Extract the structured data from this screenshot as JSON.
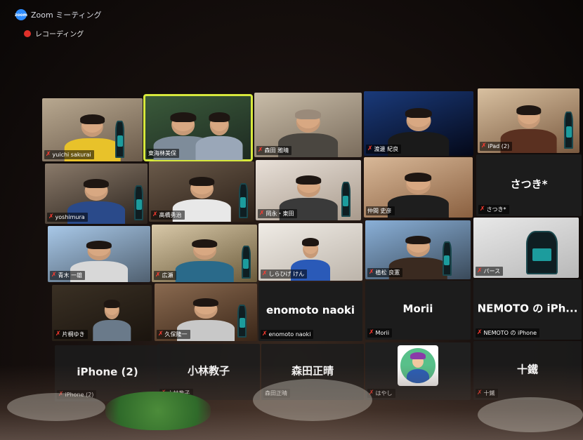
{
  "window": {
    "title": "Zoom ミーティング",
    "logo_text": "zoom"
  },
  "recording": {
    "label": "レコーディング"
  },
  "mic_muted_glyph": "✗",
  "colors": {
    "active_speaker_border": "#d7e83c",
    "muted_mic": "#ff3b30",
    "recording_dot": "#e0302a",
    "zoom_blue": "#2d8cff"
  },
  "participants": [
    {
      "name": "yuichi sakurai",
      "muted": true,
      "video": true
    },
    {
      "name": "東海林美保",
      "muted": false,
      "video": true,
      "active_speaker": true
    },
    {
      "name": "森田 雅晴",
      "muted": true,
      "video": true
    },
    {
      "name": "渡邊 紀良",
      "muted": true,
      "video": true
    },
    {
      "name": "iPad (2)",
      "muted": true,
      "video": true
    },
    {
      "name": "yoshimura",
      "muted": true,
      "video": true
    },
    {
      "name": "髙橋勇治",
      "muted": true,
      "video": true
    },
    {
      "name": "岡永・東田",
      "muted": true,
      "video": true
    },
    {
      "name": "仲間 史彦",
      "muted": false,
      "video": true
    },
    {
      "name": "さつき*",
      "display": "さつき*",
      "muted": true,
      "video": false
    },
    {
      "name": "青木 一雄",
      "muted": true,
      "video": true
    },
    {
      "name": "広瀬",
      "muted": true,
      "video": true
    },
    {
      "name": "しらひげ けん",
      "muted": true,
      "video": true
    },
    {
      "name": "植松 良憲",
      "muted": true,
      "video": true
    },
    {
      "name": "パース",
      "muted": true,
      "video": true
    },
    {
      "name": "片桐ゆき",
      "muted": true,
      "video": true
    },
    {
      "name": "久保隆一",
      "muted": true,
      "video": true
    },
    {
      "name": "enomoto naoki",
      "display": "enomoto naoki",
      "muted": true,
      "video": false
    },
    {
      "name": "Morii",
      "display": "Morii",
      "muted": true,
      "video": false
    },
    {
      "name": "NEMOTO の iPhone",
      "display": "NEMOTO の iPh...",
      "muted": true,
      "video": false
    },
    {
      "name": "iPhone (2)",
      "display": "iPhone (2)",
      "muted": true,
      "video": false
    },
    {
      "name": "小林教子",
      "display": "小林教子",
      "muted": true,
      "video": false
    },
    {
      "name": "森田正晴",
      "display": "森田正晴",
      "muted": false,
      "video": false
    },
    {
      "name": "はやし",
      "muted": true,
      "video": false,
      "avatar": true
    },
    {
      "name": "十鐵",
      "display": "十鐵",
      "muted": true,
      "video": false
    }
  ]
}
